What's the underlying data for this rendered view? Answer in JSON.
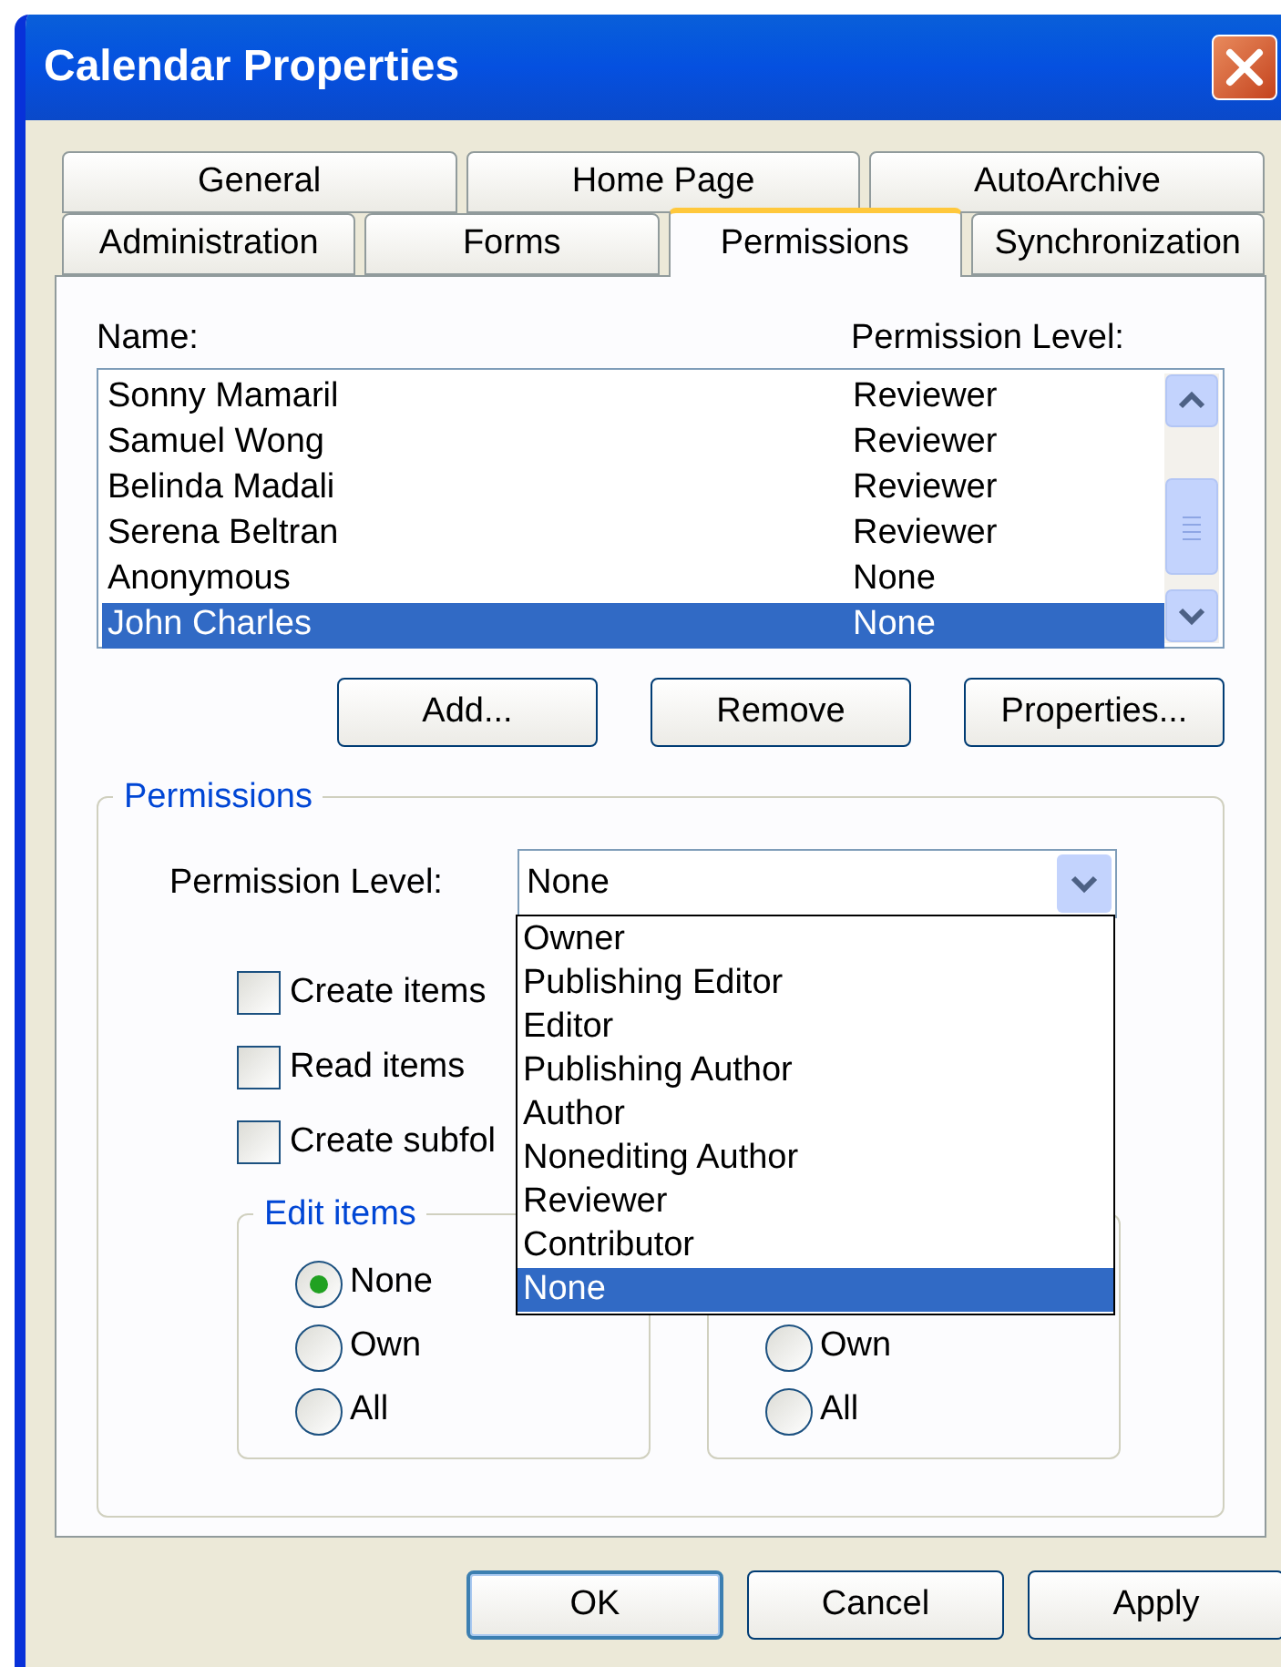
{
  "window": {
    "title": "Calendar Properties"
  },
  "tab_rows": [
    {
      "tabs": [
        {
          "label": "General",
          "selected": false
        },
        {
          "label": "Home Page",
          "selected": false
        },
        {
          "label": "AutoArchive",
          "selected": false
        }
      ]
    },
    {
      "tabs": [
        {
          "label": "Administration",
          "selected": false
        },
        {
          "label": "Forms",
          "selected": false
        },
        {
          "label": "Permissions",
          "selected": true
        },
        {
          "label": "Synchronization",
          "selected": false
        }
      ]
    }
  ],
  "user_list": {
    "columns": [
      "Name:",
      "Permission Level:"
    ],
    "rows": [
      {
        "name": "Sonny Mamaril",
        "permission": "Reviewer",
        "selected": false
      },
      {
        "name": "Samuel Wong",
        "permission": "Reviewer",
        "selected": false
      },
      {
        "name": "Belinda Madali",
        "permission": "Reviewer",
        "selected": false
      },
      {
        "name": "Serena Beltran",
        "permission": "Reviewer",
        "selected": false
      },
      {
        "name": "Anonymous",
        "permission": "None",
        "selected": false
      },
      {
        "name": "John Charles",
        "permission": "None",
        "selected": true
      }
    ]
  },
  "list_buttons": [
    "Add...",
    "Remove",
    "Properties..."
  ],
  "permissions": {
    "title": "Permissions",
    "level_label": "Permission Level:",
    "level_value": "None",
    "dropdown_options": [
      {
        "label": "Owner",
        "selected": false
      },
      {
        "label": "Publishing Editor",
        "selected": false
      },
      {
        "label": "Editor",
        "selected": false
      },
      {
        "label": "Publishing Author",
        "selected": false
      },
      {
        "label": "Author",
        "selected": false
      },
      {
        "label": "Nonediting Author",
        "selected": false
      },
      {
        "label": "Reviewer",
        "selected": false
      },
      {
        "label": "Contributor",
        "selected": false
      },
      {
        "label": "None",
        "selected": true
      }
    ],
    "checkboxes": [
      {
        "label": "Create items",
        "checked": false
      },
      {
        "label": "Read items",
        "checked": false
      },
      {
        "label": "Create subfol",
        "checked": false
      }
    ],
    "groups": [
      {
        "title": "Edit items",
        "options": [
          {
            "label": "None",
            "selected": true
          },
          {
            "label": "Own",
            "selected": false
          },
          {
            "label": "All",
            "selected": false
          }
        ]
      },
      {
        "options": [
          {
            "label": "Own",
            "selected": false
          },
          {
            "label": "All",
            "selected": false
          }
        ]
      }
    ]
  },
  "footer_buttons": [
    {
      "label": "OK",
      "default": true
    },
    {
      "label": "Cancel",
      "default": false
    },
    {
      "label": "Apply",
      "default": false
    }
  ]
}
